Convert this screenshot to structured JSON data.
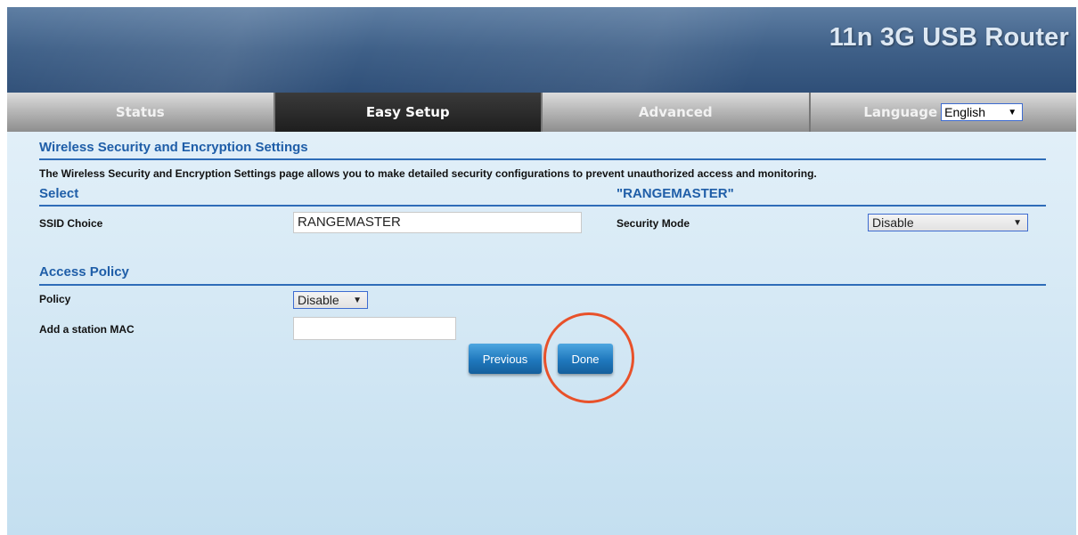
{
  "header": {
    "title": "11n 3G USB Router"
  },
  "tabs": [
    {
      "label": "Status"
    },
    {
      "label": "Easy Setup",
      "active": true
    },
    {
      "label": "Advanced"
    }
  ],
  "language": {
    "label": "Language",
    "selected": "English"
  },
  "page": {
    "title": "Wireless Security and Encryption Settings",
    "description": "The Wireless Security and Encryption Settings page allows you to make detailed security configurations to prevent unauthorized access and monitoring."
  },
  "select_section": {
    "title": "Select",
    "ssid_heading": "\"RANGEMASTER\"",
    "ssid_choice_label": "SSID Choice",
    "ssid_choice_value": "RANGEMASTER",
    "security_mode_label": "Security Mode",
    "security_mode_value": "Disable"
  },
  "access_policy": {
    "title": "Access Policy",
    "policy_label": "Policy",
    "policy_value": "Disable",
    "add_mac_label": "Add a station MAC",
    "add_mac_value": ""
  },
  "buttons": {
    "previous": "Previous",
    "done": "Done"
  },
  "colors": {
    "accent": "#1f5ea8",
    "button": "#1f78bd",
    "highlight": "#e8512a"
  },
  "icons": {
    "dropdown": "triangle-down"
  }
}
